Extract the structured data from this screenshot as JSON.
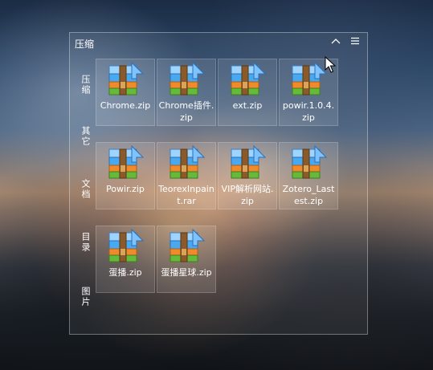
{
  "panel": {
    "title": "压缩",
    "collapse_icon": "chevron-up-icon",
    "menu_icon": "hamburger-menu-icon"
  },
  "side_labels": [
    "压缩",
    "其它",
    "文档",
    "目录",
    "图片"
  ],
  "files": [
    {
      "name": "Chrome.zip",
      "icon": "winrar-archive-icon"
    },
    {
      "name": "Chrome插件.zip",
      "icon": "winrar-archive-icon"
    },
    {
      "name": "ext.zip",
      "icon": "winrar-archive-icon"
    },
    {
      "name": "powir.1.0.4.zip",
      "icon": "winrar-archive-icon"
    },
    {
      "name": "Powir.zip",
      "icon": "winrar-archive-icon"
    },
    {
      "name": "TeorexInpaint.rar",
      "icon": "winrar-archive-icon"
    },
    {
      "name": "VIP解析网站.zip",
      "icon": "winrar-archive-icon"
    },
    {
      "name": "Zotero_Lastest.zip",
      "icon": "winrar-archive-icon"
    },
    {
      "name": "蛋播.zip",
      "icon": "winrar-archive-icon"
    },
    {
      "name": "蛋播星球.zip",
      "icon": "winrar-archive-icon"
    }
  ]
}
